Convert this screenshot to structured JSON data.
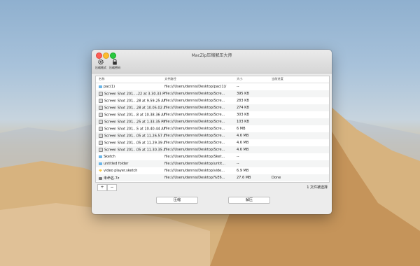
{
  "window": {
    "title": "MacZip压缩解压大师",
    "toolbar": [
      {
        "label": "压缩格式",
        "icon": "gear-icon"
      },
      {
        "label": "压缩密码",
        "icon": "lock-icon"
      }
    ]
  },
  "table": {
    "columns": [
      "名称",
      "文件路径",
      "大小",
      "当前进度"
    ],
    "rows": [
      {
        "name": "pac(1)",
        "path": "file:///Users/dennis/Desktop/pac(1)/",
        "size": "--",
        "status": "",
        "icon": "folder-icon"
      },
      {
        "name": "Screen Shot 201...-22 at 3.30.33 PM",
        "path": "file:///Users/dennis/Desktop/Scre...",
        "size": "395 KB",
        "status": "",
        "icon": "image-icon"
      },
      {
        "name": "Screen Shot 201...28 at 9.59.25 AM",
        "path": "file:///Users/dennis/Desktop/Scre...",
        "size": "283 KB",
        "status": "",
        "icon": "image-icon"
      },
      {
        "name": "Screen Shot 201...28 at 10.05.02 AM",
        "path": "file:///Users/dennis/Desktop/Scre...",
        "size": "274 KB",
        "status": "",
        "icon": "image-icon"
      },
      {
        "name": "Screen Shot 201...8 at 10.38.36 AM",
        "path": "file:///Users/dennis/Desktop/Scre...",
        "size": "303 KB",
        "status": "",
        "icon": "image-icon"
      },
      {
        "name": "Screen Shot 201...25 at 1.33.35 PM",
        "path": "file:///Users/dennis/Desktop/Scre...",
        "size": "103 KB",
        "status": "",
        "icon": "image-icon"
      },
      {
        "name": "Screen Shot 201...5 at 10.40.44 AM",
        "path": "file:///Users/dennis/Desktop/Scre...",
        "size": "6 MB",
        "status": "",
        "icon": "image-icon"
      },
      {
        "name": "Screen Shot 201...05 at 11.26.57 AM",
        "path": "file:///Users/dennis/Desktop/Scre...",
        "size": "4.6 MB",
        "status": "",
        "icon": "image-icon"
      },
      {
        "name": "Screen Shot 201...05 at 11.29.39 AM",
        "path": "file:///Users/dennis/Desktop/Scre...",
        "size": "4.6 MB",
        "status": "",
        "icon": "image-icon"
      },
      {
        "name": "Screen Shot 201...05 at 11.30.35 AM",
        "path": "file:///Users/dennis/Desktop/Scre...",
        "size": "4.6 MB",
        "status": "",
        "icon": "image-icon"
      },
      {
        "name": "Sketch",
        "path": "file:///Users/dennis/Desktop/Sket...",
        "size": "--",
        "status": "",
        "icon": "folder-icon"
      },
      {
        "name": "untitled folder",
        "path": "file:///Users/dennis/Desktop/untit...",
        "size": "--",
        "status": "",
        "icon": "folder-icon"
      },
      {
        "name": "video player.sketch",
        "path": "file:///Users/dennis/Desktop/vide...",
        "size": "6.9 MB",
        "status": "",
        "icon": "sketch-icon"
      },
      {
        "name": "未命名.7z",
        "path": "file:///Users/dennis/Desktop/%E6...",
        "size": "27.6 MB",
        "status": "Done",
        "icon": "zip-icon"
      }
    ]
  },
  "footer": {
    "add_label": "+",
    "remove_label": "−",
    "selection": "1 文件被选择",
    "compress_label": "压缩",
    "extract_label": "解压"
  }
}
